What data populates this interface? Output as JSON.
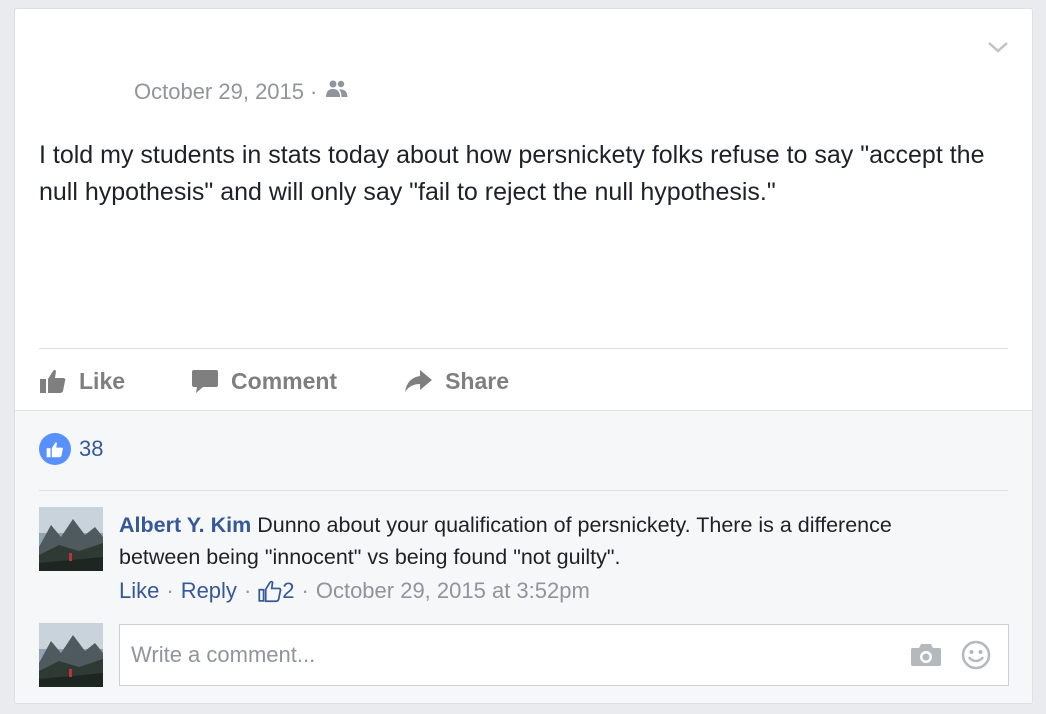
{
  "post": {
    "timestamp": "October 29, 2015",
    "separator": "·",
    "privacy_icon": "friends-icon",
    "text": "I told my students in stats today about how persnickety folks refuse to say \"accept the null hypothesis\" and will only say \"fail to reject the null hypothesis.\""
  },
  "actions": {
    "like_label": "Like",
    "comment_label": "Comment",
    "share_label": "Share"
  },
  "reactions": {
    "count": "38"
  },
  "comment": {
    "author": "Albert Y. Kim",
    "text": " Dunno about your qualification of persnickety. There is a difference between being \"innocent\" vs being found \"not guilty\".",
    "like_label": "Like",
    "reply_label": "Reply",
    "like_count": "2",
    "separator": "·",
    "timestamp": "October 29, 2015 at 3:52pm"
  },
  "composer": {
    "placeholder": "Write a comment..."
  },
  "colors": {
    "link": "#365899",
    "muted": "#90949c",
    "like_blue": "#5890ff",
    "action_gray": "#7f7f7f"
  }
}
